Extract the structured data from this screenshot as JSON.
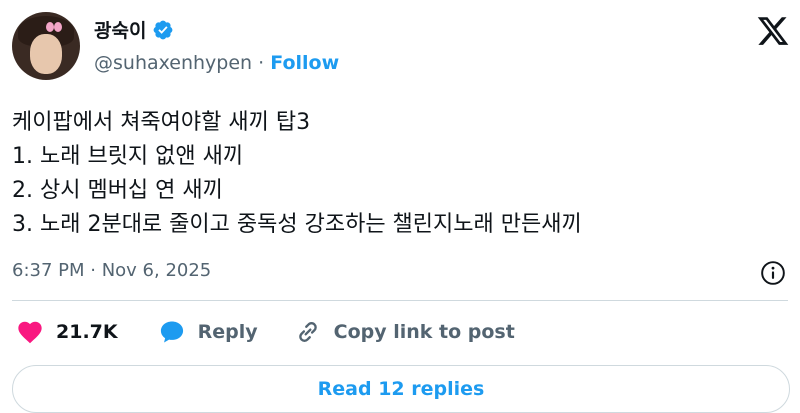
{
  "author": {
    "display_name": "광숙이",
    "handle": "@suhaxenhypen",
    "separator": " · ",
    "follow_label": "Follow"
  },
  "tweet": {
    "text": "케이팝에서 쳐죽여야할 새끼 탑3\n1. 노래 브릿지 없앤 새끼\n2. 상시 멤버십 연 새끼\n3. 노래 2분대로 줄이고 중독성 강조하는 챌린지노래 만든새끼",
    "timestamp": "6:37 PM · Nov 6, 2025"
  },
  "actions": {
    "like_count": "21.7K",
    "reply_label": "Reply",
    "copy_link_label": "Copy link to post"
  },
  "footer": {
    "read_replies_label": "Read 12 replies"
  },
  "colors": {
    "accent": "#1d9bf0",
    "like": "#f91880",
    "muted": "#536471"
  }
}
